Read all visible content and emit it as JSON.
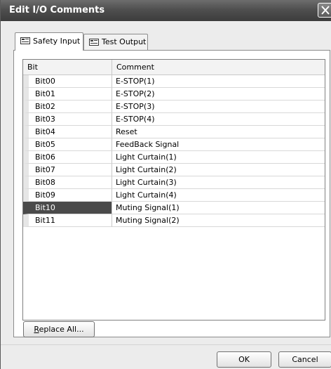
{
  "window": {
    "title": "Edit I/O Comments"
  },
  "tabs": [
    {
      "label": "Safety Input",
      "active": true
    },
    {
      "label": "Test Output",
      "active": false
    }
  ],
  "table": {
    "columns": [
      "Bit",
      "Comment"
    ],
    "rows": [
      {
        "bit": "Bit00",
        "comment": "E-STOP(1)"
      },
      {
        "bit": "Bit01",
        "comment": "E-STOP(2)"
      },
      {
        "bit": "Bit02",
        "comment": "E-STOP(3)"
      },
      {
        "bit": "Bit03",
        "comment": "E-STOP(4)"
      },
      {
        "bit": "Bit04",
        "comment": "Reset"
      },
      {
        "bit": "Bit05",
        "comment": "FeedBack Signal"
      },
      {
        "bit": "Bit06",
        "comment": "Light Curtain(1)"
      },
      {
        "bit": "Bit07",
        "comment": "Light Curtain(2)"
      },
      {
        "bit": "Bit08",
        "comment": "Light Curtain(3)"
      },
      {
        "bit": "Bit09",
        "comment": "Light Curtain(4)"
      },
      {
        "bit": "Bit10",
        "comment": "Muting Signal(1)",
        "selected": true
      },
      {
        "bit": "Bit11",
        "comment": "Muting Signal(2)"
      }
    ]
  },
  "buttons": {
    "replace_all_prefix": "",
    "replace_all_mnemonic": "R",
    "replace_all_rest": "eplace All...",
    "ok": "OK",
    "cancel": "Cancel"
  },
  "icons": {
    "tab_icon": "io-card-icon",
    "close": "close-icon"
  },
  "colors": {
    "titlebar": "#4f4f4f",
    "selection": "#4a4a4a"
  }
}
